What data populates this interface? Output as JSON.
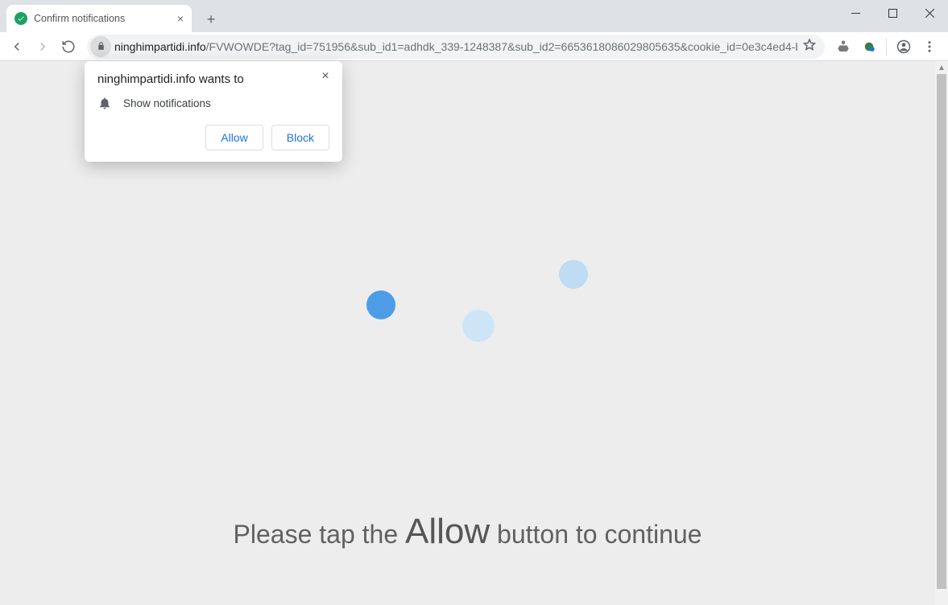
{
  "tab": {
    "title": "Confirm notifications"
  },
  "url": {
    "host": "ninghimpartidi.info",
    "path": "/FVWOWDE?tag_id=751956&sub_id1=adhdk_339-1248387&sub_id2=6653618086029805635&cookie_id=0e3c4ed4-b..."
  },
  "permission": {
    "title": "ninghimpartidi.info wants to",
    "request": "Show notifications",
    "allow": "Allow",
    "block": "Block"
  },
  "page_message": {
    "before": "Please tap the ",
    "highlight": "Allow",
    "after": " button to continue"
  }
}
